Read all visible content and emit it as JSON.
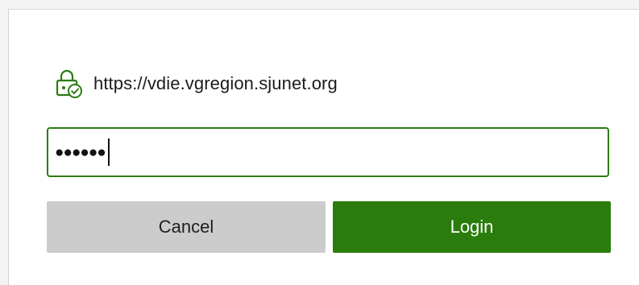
{
  "dialog": {
    "origin_url": "https://vdie.vgregion.sjunet.org",
    "origin_icon": "lock-check-icon",
    "password": {
      "masked_value": "●●●●●●",
      "length": 6
    },
    "cancel_label": "Cancel",
    "login_label": "Login"
  },
  "colors": {
    "accent": "#2a7d0c",
    "field_border": "#2a7d14",
    "cancel_bg": "#cccccc",
    "background": "#ffffff"
  }
}
